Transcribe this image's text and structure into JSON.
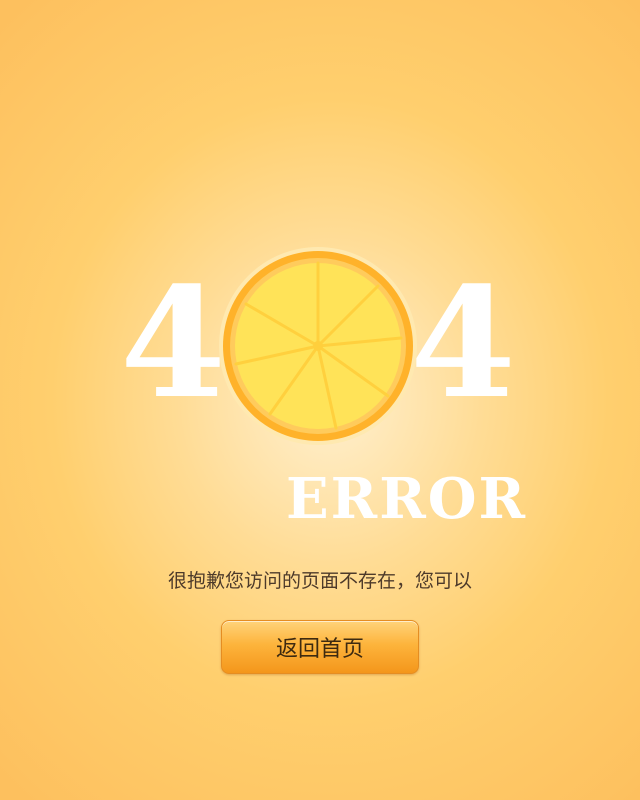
{
  "error": {
    "digit_left": "4",
    "digit_right": "4",
    "word": "ERROR"
  },
  "message": "很抱歉您访问的页面不存在，您可以",
  "home_button": {
    "label": "返回首页"
  },
  "colors": {
    "background": "#FDC05E",
    "lemon_rind": "#FFB22A",
    "lemon_flesh": "#FFE358",
    "button": "#F9A82C",
    "text": "#4D3A2A"
  },
  "icons": {
    "lemon": "lemon-slice-icon"
  }
}
